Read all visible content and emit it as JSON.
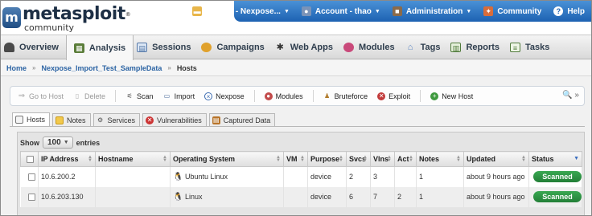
{
  "app": {
    "logo_name": "metasploit",
    "logo_trademark": "®",
    "logo_sub": "community"
  },
  "topbar": {
    "items": [
      {
        "label": "Project - Nexpose...",
        "caret": "▼",
        "icon": "folder-icon"
      },
      {
        "label": "Account - thao",
        "caret": "▼",
        "icon": "user-icon"
      },
      {
        "label": "Administration",
        "caret": "▼",
        "icon": "briefcase-icon"
      },
      {
        "label": "Community",
        "icon": "community-icon"
      },
      {
        "label": "Help",
        "icon": "help-icon"
      }
    ]
  },
  "nav": {
    "tabs": [
      {
        "label": "Overview",
        "icon": "dashboard-icon"
      },
      {
        "label": "Analysis",
        "icon": "analysis-icon",
        "active": true
      },
      {
        "label": "Sessions",
        "icon": "sessions-icon"
      },
      {
        "label": "Campaigns",
        "icon": "campaigns-icon"
      },
      {
        "label": "Web Apps",
        "icon": "web-apps-icon"
      },
      {
        "label": "Modules",
        "icon": "modules-icon"
      },
      {
        "label": "Tags",
        "icon": "tags-icon"
      },
      {
        "label": "Reports",
        "icon": "reports-icon"
      },
      {
        "label": "Tasks",
        "icon": "tasks-icon"
      }
    ]
  },
  "breadcrumb": {
    "items": [
      "Home",
      "Nexpose_Import_Test_SampleData",
      "Hosts"
    ],
    "separator": "»"
  },
  "actions": {
    "items": [
      {
        "label": "Go to Host",
        "disabled": true,
        "icon": "arrow-right-icon"
      },
      {
        "label": "Delete",
        "disabled": true,
        "icon": "trash-icon"
      },
      {
        "label": "Scan",
        "icon": "scan-icon"
      },
      {
        "label": "Import",
        "icon": "import-icon"
      },
      {
        "label": "Nexpose",
        "icon": "nexpose-icon"
      },
      {
        "label": "Modules",
        "icon": "modules-icon"
      },
      {
        "label": "Bruteforce",
        "icon": "bruteforce-icon"
      },
      {
        "label": "Exploit",
        "icon": "exploit-icon"
      },
      {
        "label": "New Host",
        "icon": "add-icon"
      }
    ],
    "right_glyphs": "🔍 »"
  },
  "subtabs": {
    "items": [
      {
        "label": "Hosts",
        "active": true,
        "icon": "hosts-icon"
      },
      {
        "label": "Notes",
        "icon": "notes-icon"
      },
      {
        "label": "Services",
        "icon": "services-icon"
      },
      {
        "label": "Vulnerabilities",
        "icon": "vulnerabilities-icon"
      },
      {
        "label": "Captured Data",
        "icon": "captured-data-icon"
      }
    ]
  },
  "table": {
    "show_label": "Show",
    "page_size": "100",
    "entries_label": "entries",
    "columns": [
      "IP Address",
      "Hostname",
      "Operating System",
      "VM",
      "Purpose",
      "Svcs",
      "Vlns",
      "Act",
      "Notes",
      "Updated",
      "Status"
    ],
    "rows": [
      {
        "ip": "10.6.200.2",
        "hostname": "",
        "os": "Ubuntu Linux",
        "vm": "",
        "purpose": "device",
        "svcs": "2",
        "vlns": "3",
        "act": "",
        "notes": "1",
        "updated": "about 9 hours ago",
        "status": "Scanned"
      },
      {
        "ip": "10.6.203.130",
        "hostname": "",
        "os": "Linux",
        "vm": "",
        "purpose": "device",
        "svcs": "6",
        "vlns": "7",
        "act": "2",
        "notes": "1",
        "updated": "about 9 hours ago",
        "status": "Scanned"
      }
    ]
  },
  "colors": {
    "topbar_blue": "#1d62b2",
    "status_green": "#2f9645",
    "link_blue": "#1f5aa8"
  }
}
